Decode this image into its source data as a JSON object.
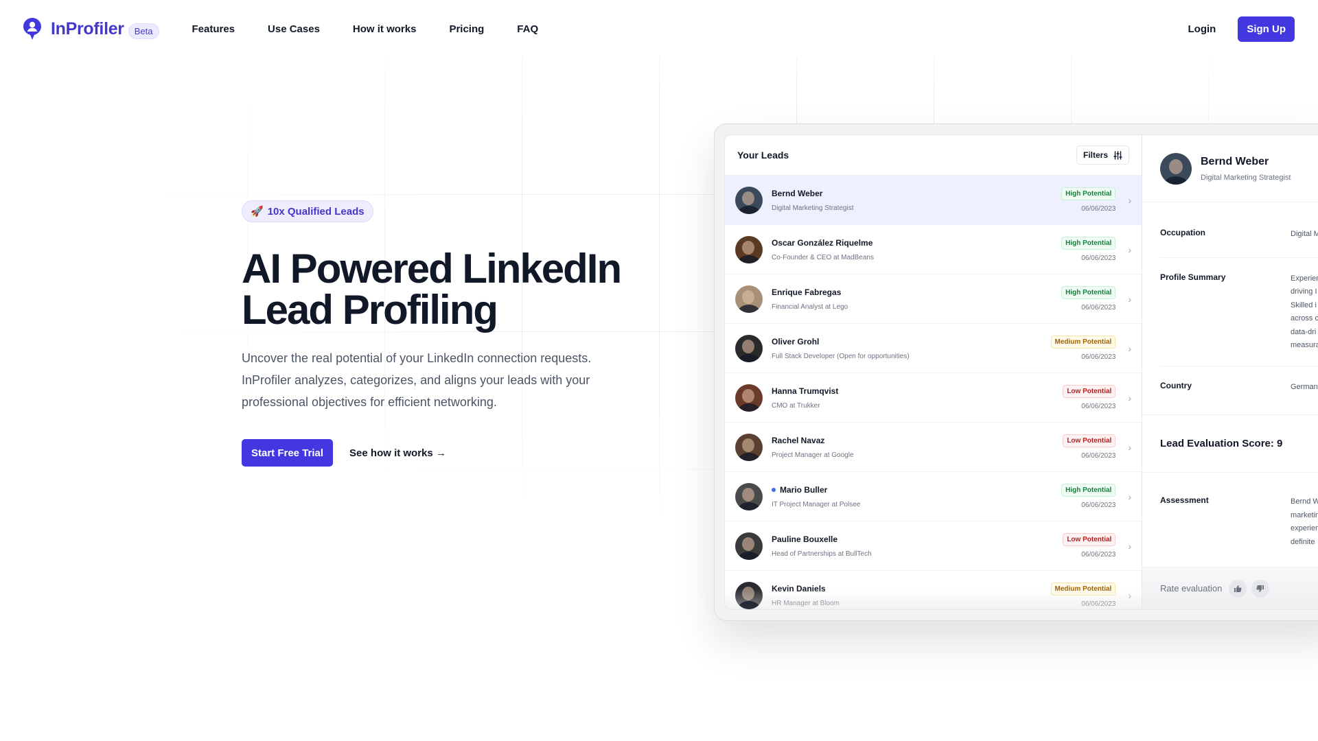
{
  "header": {
    "brand": "InProfiler",
    "badge": "Beta",
    "nav": [
      "Features",
      "Use Cases",
      "How it works",
      "Pricing",
      "FAQ"
    ],
    "login": "Login",
    "signup": "Sign Up"
  },
  "hero": {
    "pill_icon": "🚀",
    "pill": "10x Qualified Leads",
    "title_line1": "AI Powered LinkedIn",
    "title_line2": "Lead Profiling",
    "description": "Uncover the real potential of your LinkedIn connection requests. InProfiler analyzes, categorizes, and aligns your leads with your professional objectives for efficient networking.",
    "cta_primary": "Start Free Trial",
    "cta_secondary": "See how it works →"
  },
  "colors": {
    "accent": "#4338e0",
    "high": "#15803d",
    "medium": "#a16207",
    "low": "#b91c1c"
  },
  "app": {
    "leads_title": "Your Leads",
    "filters_label": "Filters",
    "leads": [
      {
        "name": "Bernd Weber",
        "title": "Digital Marketing Strategist",
        "potential": "High Potential",
        "level": "high",
        "date": "06/06/2023",
        "selected": true,
        "unread": false,
        "avatar": "#3a4a5a"
      },
      {
        "name": "Oscar González Riquelme",
        "title": "Co-Founder & CEO at MadBeans",
        "potential": "High Potential",
        "level": "high",
        "date": "06/06/2023",
        "selected": false,
        "unread": false,
        "avatar": "#5a3a22"
      },
      {
        "name": "Enrique Fabregas",
        "title": "Financial Analyst at Lego",
        "potential": "High Potential",
        "level": "high",
        "date": "06/06/2023",
        "selected": false,
        "unread": false,
        "avatar": "#a89078"
      },
      {
        "name": "Oliver Grohl",
        "title": "Full Stack Developer (Open for opportunities)",
        "potential": "Medium Potential",
        "level": "medium",
        "date": "06/06/2023",
        "selected": false,
        "unread": false,
        "avatar": "#2a2a2a"
      },
      {
        "name": "Hanna Trumqvist",
        "title": "CMO at Trukker",
        "potential": "Low Potential",
        "level": "low",
        "date": "06/06/2023",
        "selected": false,
        "unread": false,
        "avatar": "#6a3a2a"
      },
      {
        "name": "Rachel Navaz",
        "title": "Project Manager at Google",
        "potential": "Low Potential",
        "level": "low",
        "date": "06/06/2023",
        "selected": false,
        "unread": false,
        "avatar": "#5a4030"
      },
      {
        "name": "Mario Buller",
        "title": "IT Project Manager at Polsee",
        "potential": "High Potential",
        "level": "high",
        "date": "06/06/2023",
        "selected": false,
        "unread": true,
        "avatar": "#4a4a4a"
      },
      {
        "name": "Pauline Bouxelle",
        "title": "Head of Partnerships at BullTech",
        "potential": "Low Potential",
        "level": "low",
        "date": "06/06/2023",
        "selected": false,
        "unread": false,
        "avatar": "#3a3a3a"
      },
      {
        "name": "Kevin Daniels",
        "title": "HR Manager at Bloom",
        "potential": "Medium Potential",
        "level": "medium",
        "date": "06/06/2023",
        "selected": false,
        "unread": false,
        "avatar": "#2a2a30"
      }
    ],
    "detail": {
      "name": "Bernd Weber",
      "title": "Digital Marketing Strategist",
      "occupation_label": "Occupation",
      "occupation_value": "Digital M",
      "summary_label": "Profile Summary",
      "summary_lines": [
        "Experien",
        "driving I",
        "Skilled i",
        "across c",
        "data-dri",
        "measura"
      ],
      "country_label": "Country",
      "country_value": "German",
      "score_label": "Lead Evaluation Score: 9",
      "assessment_label": "Assessment",
      "assessment_lines": [
        "Bernd W",
        "marketin",
        "experien",
        "definite"
      ],
      "rate_label": "Rate evaluation"
    }
  }
}
